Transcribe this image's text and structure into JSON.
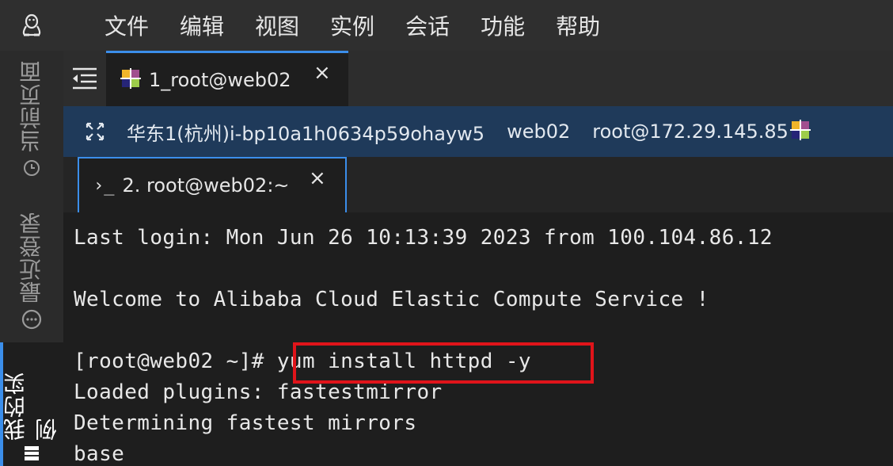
{
  "menubar": {
    "logo_icon": "penguin-icon",
    "items": [
      "文件",
      "编辑",
      "视图",
      "实例",
      "会话",
      "功能",
      "帮助"
    ]
  },
  "sidebar": {
    "items": [
      {
        "label": "当前页面",
        "icon": "clock-icon"
      },
      {
        "label": "最近登录",
        "icon": "chat-icon"
      },
      {
        "label": "我的实例",
        "icon": "list-icon",
        "active": true
      }
    ]
  },
  "session_tab": {
    "label": "1_root@web02",
    "close": "×",
    "icon": "centos-icon"
  },
  "infobar": {
    "region_instance": "华东1(杭州)i-bp10a1h0634p59ohayw5",
    "hostname": "web02",
    "address": "root@172.29.145.85"
  },
  "terminal_tab": {
    "icon": "›_",
    "label": "2. root@web02:~",
    "close": "×"
  },
  "terminal": {
    "lines": [
      "Last login: Mon Jun 26 10:13:39 2023 from 100.104.86.12",
      "",
      "Welcome to Alibaba Cloud Elastic Compute Service !",
      "",
      "[root@web02 ~]# yum install httpd -y",
      "Loaded plugins: fastestmirror",
      "Determining fastest mirrors",
      "base"
    ],
    "highlight_color": "#e0141a"
  },
  "colors": {
    "accent": "#3b8eea",
    "infobar_bg": "#1f3a5a",
    "terminal_bg": "#1e1e1e"
  }
}
